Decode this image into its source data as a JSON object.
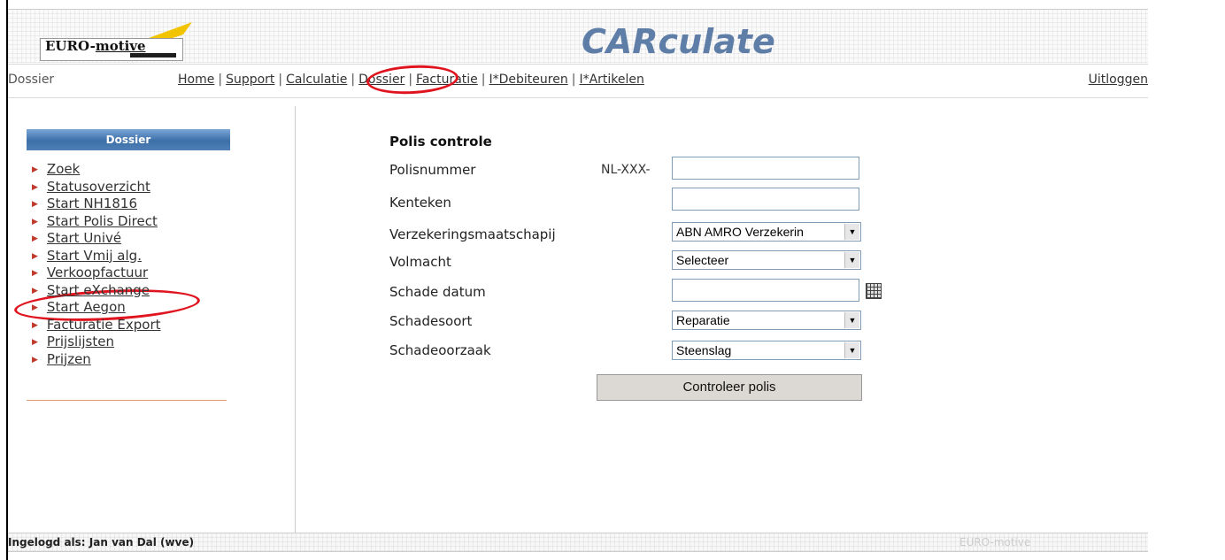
{
  "header": {
    "logo_text_1": "EURO-",
    "logo_text_2": "motive",
    "app_title": "CARculate"
  },
  "nav": {
    "section": "Dossier",
    "links": [
      "Home",
      "Support",
      "Calculatie",
      "Dossier",
      "Facturatie",
      "I*Debiteuren",
      "I*Artikelen"
    ],
    "separator": "|",
    "logout": "Uitloggen"
  },
  "sidebar": {
    "title": "Dossier",
    "items": [
      "Zoek",
      "Statusoverzicht",
      "Start NH1816",
      "Start Polis Direct",
      "Start Univé",
      "Start Vmij alg.",
      "Verkoopfactuur",
      "Start eXchange",
      "Start Aegon",
      "Facturatie Export",
      "Prijslijsten",
      "Prijzen"
    ]
  },
  "form": {
    "title": "Polis controle",
    "polisnummer_label": "Polisnummer",
    "polisnummer_prefix": "NL-XXX-",
    "polisnummer_value": "",
    "kenteken_label": "Kenteken",
    "kenteken_value": "",
    "verzekering_label": "Verzekeringsmaatschapij",
    "verzekering_value": "ABN AMRO Verzekerin",
    "volmacht_label": "Volmacht",
    "volmacht_value": "Selecteer",
    "schadedatum_label": "Schade datum",
    "schadedatum_value": "",
    "schadesoort_label": "Schadesoort",
    "schadesoort_value": "Reparatie",
    "schadeoorzaak_label": "Schadeoorzaak",
    "schadeoorzaak_value": "Steenslag",
    "submit_label": "Controleer polis"
  },
  "footer": {
    "login_text": "Ingelogd als: Jan van Dal (wve)",
    "brand": "EURO-motive"
  },
  "colors": {
    "highlight": "#e0141e",
    "title_blue": "#5e7ea8",
    "sidebar_header": "#3d6fa8",
    "bullet": "#c0392b"
  }
}
